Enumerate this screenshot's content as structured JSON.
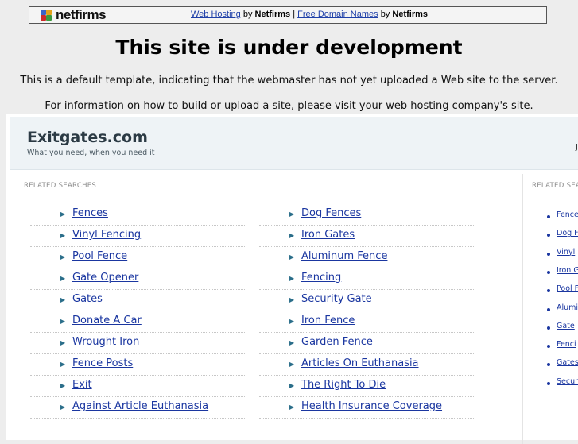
{
  "banner": {
    "logo_text": "netfirms",
    "web_hosting_link": "Web Hosting",
    "by_1": "by",
    "brand_1": "Netfirms",
    "separator": "|",
    "free_domain_link": "Free Domain Names",
    "by_2": "by",
    "brand_2": "Netfirms"
  },
  "notice": {
    "title": "This site is under development",
    "line1": "This is a default template, indicating that the webmaster has not yet uploaded a Web site to the server.",
    "line2": "For information on how to build or upload a site, please visit your web hosting company's site."
  },
  "parked": {
    "site_name": "Exitgates.com",
    "tagline": "What you need, when you need it",
    "header_cut_text": "J",
    "related_title": "RELATED SEARCHES",
    "left_column": [
      "Fences",
      "Vinyl Fencing",
      "Pool Fence",
      "Gate Opener",
      "Gates",
      "Donate A Car",
      "Wrought Iron",
      "Fence Posts",
      "Exit",
      "Against Article Euthanasia"
    ],
    "right_column": [
      "Dog Fences",
      "Iron Gates",
      "Aluminum Fence",
      "Fencing",
      "Security Gate",
      "Iron Fence",
      "Garden Fence",
      "Articles On Euthanasia",
      "The Right To Die",
      "Health Insurance Coverage"
    ],
    "sidebar_title": "RELATED SEA",
    "sidebar_items": [
      "Fence",
      "Dog F",
      "Vinyl",
      "Iron G",
      "Pool F",
      "Alumi",
      "Gate",
      "Fenci",
      "Gates",
      "Secur"
    ]
  },
  "colors": {
    "link": "#1a36a0",
    "background": "#ededed",
    "header_bg": "#eef3f6"
  }
}
